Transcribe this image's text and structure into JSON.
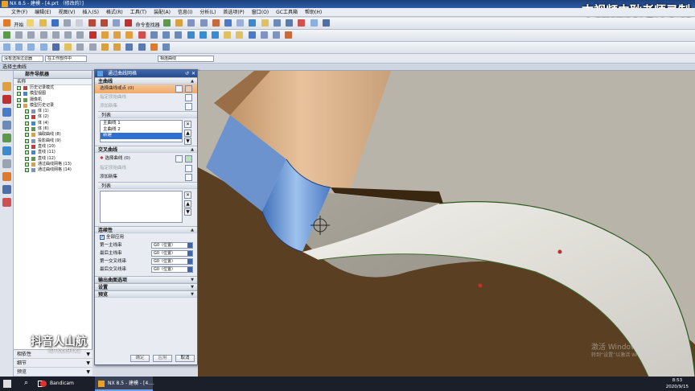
{
  "window": {
    "title": "NX 8.5 - 建模 - [4.prt （修改的）]"
  },
  "watermark": "本视频由耿老师录制",
  "menu": [
    "文件(F)",
    "编辑(E)",
    "视图(V)",
    "插入(S)",
    "格式(R)",
    "工具(T)",
    "装配(A)",
    "信息(I)",
    "分析(L)",
    "首选项(P)",
    "窗口(O)",
    "GC工具箱",
    "帮助(H)"
  ],
  "toolbar": {
    "start_label": "开始",
    "snap_label": "命令查找器",
    "filter_value": "没有选择过滤器",
    "scope_value": "在工作部件中",
    "curve_rule": "相连曲线"
  },
  "selection_bar": {
    "label": "选择主曲线"
  },
  "navigator": {
    "title": "部件导航器",
    "column_name": "名称",
    "items": [
      {
        "label": "历史记录模式",
        "indent": 1
      },
      {
        "label": "模型视图",
        "indent": 1
      },
      {
        "label": "摄像机",
        "indent": 1
      },
      {
        "label": "模型历史记录",
        "indent": 1
      },
      {
        "label": "体 (1)",
        "indent": 2
      },
      {
        "label": "体 (2)",
        "indent": 2
      },
      {
        "label": "体 (4)",
        "indent": 2
      },
      {
        "label": "体 (6)",
        "indent": 2
      },
      {
        "label": "抽取曲线 (8)",
        "indent": 2
      },
      {
        "label": "投影曲线 (9)",
        "indent": 2
      },
      {
        "label": "直线 (10)",
        "indent": 2
      },
      {
        "label": "直线 (11)",
        "indent": 2
      },
      {
        "label": "直线 (12)",
        "indent": 2
      },
      {
        "label": "通过曲线网格 (13)",
        "indent": 2
      },
      {
        "label": "通过曲线网格 (14)",
        "indent": 2
      }
    ],
    "footer": [
      "相依性",
      "细节",
      "预览"
    ]
  },
  "dialog": {
    "title": "通过曲线网格",
    "primary": {
      "section": "主曲线",
      "select_label": "选择曲线或点 (0)",
      "specify_origin": "指定原始曲线",
      "add_set": "添加新集",
      "list_header": "列表",
      "list_items": [
        "主曲线 1",
        "主曲线 2",
        "新建"
      ]
    },
    "cross": {
      "section": "交叉曲线",
      "select_label": "选择曲线 (0)",
      "specify_origin": "指定原始曲线",
      "add_set": "添加新集",
      "list_header": "列表"
    },
    "continuity": {
      "section": "连续性",
      "all_applied": "全部应用",
      "rows": [
        {
          "label": "第一主线串",
          "value": "G0（位置）"
        },
        {
          "label": "最后主线串",
          "value": "G0（位置）"
        },
        {
          "label": "第一交叉线串",
          "value": "G0（位置）"
        },
        {
          "label": "最后交叉线串",
          "value": "G0（位置）"
        }
      ]
    },
    "collapsed_sections": [
      "输出曲面选项",
      "设置",
      "预览"
    ],
    "buttons": {
      "ok": "确定",
      "apply": "应用",
      "cancel": "取消"
    }
  },
  "overlay": {
    "douyin": "抖音人山航",
    "douyin_id": "ID:Xxx9Yx1"
  },
  "viewport": {
    "activation_title": "激活 Windows",
    "activation_hint": "转到“设置”以激活 Windows。"
  },
  "taskbar": {
    "apps": [
      "Bandicam",
      "NX 8.5 - 建模 - [4...."
    ],
    "time": "8:53",
    "date": "2020/9/15"
  },
  "colors": {
    "title_blue": "#264a8a",
    "highlight_orange": "#f0a868",
    "selected_blue": "#2f6fcf",
    "model_brown": "#5a3f22"
  }
}
